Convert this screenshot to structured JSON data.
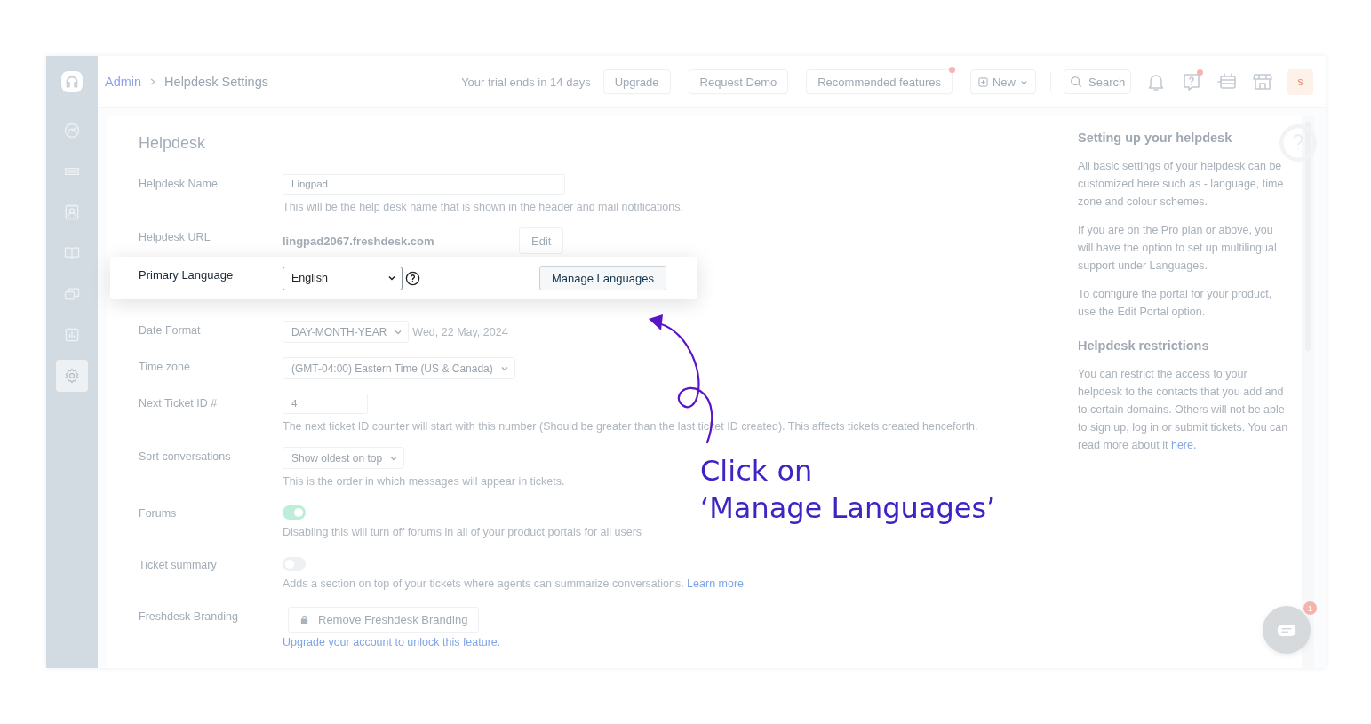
{
  "sidebar": {
    "items": [
      {
        "kind": "dashboard",
        "selected": false
      },
      {
        "kind": "tickets",
        "selected": false
      },
      {
        "kind": "contacts",
        "selected": false
      },
      {
        "kind": "book",
        "selected": false
      },
      {
        "kind": "chat",
        "selected": false
      },
      {
        "kind": "chart",
        "selected": false
      },
      {
        "kind": "gear",
        "selected": true
      }
    ]
  },
  "breadcrumb": [
    {
      "label": "Admin",
      "kind": "link"
    },
    {
      "label": "Helpdesk Settings",
      "kind": "current"
    }
  ],
  "topbar": {
    "trial": "Your trial ends in 14 days",
    "buttons": [
      {
        "label": "Upgrade",
        "dot": false
      },
      {
        "label": "Request Demo",
        "dot": false
      },
      {
        "label": "Recommended features",
        "dot": true
      }
    ],
    "new_button": "New",
    "search": {
      "placeholder": "Search"
    },
    "icons": [
      {
        "kind": "bell",
        "dot": false
      },
      {
        "kind": "help",
        "dot": true
      },
      {
        "kind": "board",
        "dot": false
      },
      {
        "kind": "store",
        "dot": false
      }
    ],
    "avatar": "s"
  },
  "form": {
    "title": "Helpdesk",
    "fields": [
      {
        "kind": "input",
        "label": "Helpdesk Name",
        "value": "Lingpad",
        "hint": "This will be the help desk name that is shown in the header and mail notifications."
      },
      {
        "kind": "url",
        "label": "Helpdesk URL",
        "value": "lingpad2067.freshdesk.com",
        "button": "Edit"
      },
      {
        "kind": "highlight",
        "label": "Primary Language",
        "value": "English",
        "button": "Manage Languages"
      },
      {
        "kind": "select",
        "label": "Date Format",
        "value": "DAY-MONTH-YEAR",
        "note": "Wed, 22 May, 2024"
      },
      {
        "kind": "select",
        "label": "Time zone",
        "value": "(GMT-04:00) Eastern Time (US & Canada)"
      },
      {
        "kind": "input",
        "label": "Next Ticket ID #",
        "value": "4",
        "hint": "The next ticket ID counter will start with this number (Should be greater than the last ticket ID created). This affects tickets created henceforth."
      },
      {
        "kind": "select",
        "label": "Sort conversations",
        "value": "Show oldest on top",
        "hint": "This is the order in which messages will appear in tickets."
      },
      {
        "kind": "toggle",
        "label": "Forums",
        "on": true,
        "hint": "Disabling this will turn off forums in all of your product portals for all users"
      },
      {
        "kind": "toggle",
        "label": "Ticket summary",
        "on": false,
        "hint": "Adds a section on top of your tickets where agents can summarize conversations.",
        "link": "Learn more"
      },
      {
        "kind": "locked",
        "label": "Freshdesk Branding",
        "button": "Remove Freshdesk Branding",
        "link": "Upgrade your account to unlock this feature."
      }
    ]
  },
  "help_panel": {
    "sections": [
      {
        "title": "Setting up your helpdesk",
        "paragraphs": [
          {
            "text": "All basic settings of your helpdesk can be customized here such as - language, time zone and colour schemes."
          },
          {
            "text": "If you are on the Pro plan or above, you will have the option to set up multilingual support under Languages."
          },
          {
            "text": "To configure the portal for your product, use the Edit Portal option."
          }
        ]
      },
      {
        "title": "Helpdesk restrictions",
        "paragraphs": [
          {
            "text": "You can restrict the access to your helpdesk to the contacts that you add and to certain domains. Others will not be able to sign up, log in or submit tickets. You can read more about it",
            "link": "here."
          }
        ]
      }
    ]
  },
  "annotation": {
    "lines": [
      "Click on",
      "‘Manage Languages’"
    ]
  },
  "chat_widget": {
    "badge": "1"
  }
}
